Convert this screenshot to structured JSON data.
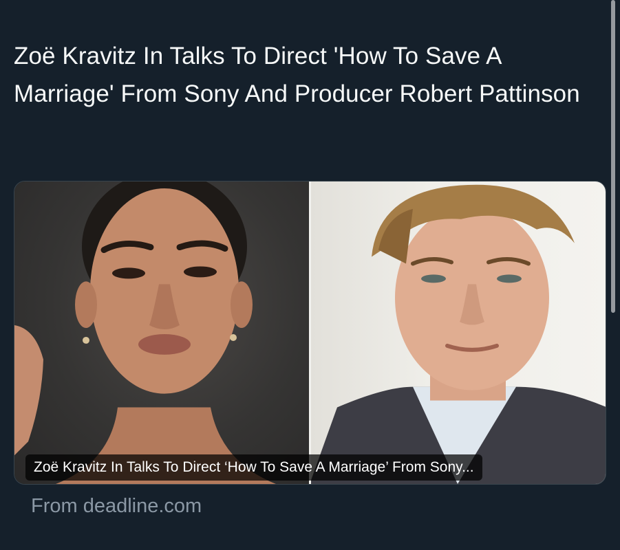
{
  "tweet": {
    "text": "Zoë Kravitz In Talks To Direct 'How To Save A Marriage' From Sony And Producer Robert Pattinson"
  },
  "link_card": {
    "caption": "Zoë Kravitz In Talks To Direct ‘How To Save A Marriage’ From Sony...",
    "source": "From deadline.com",
    "images": [
      {
        "icon": "portrait-photo-woman"
      },
      {
        "icon": "portrait-photo-man"
      }
    ]
  },
  "colors": {
    "background": "#15202b",
    "text": "#f7f9f9",
    "secondary_text": "#8b98a5",
    "card_border": "#38444d"
  }
}
